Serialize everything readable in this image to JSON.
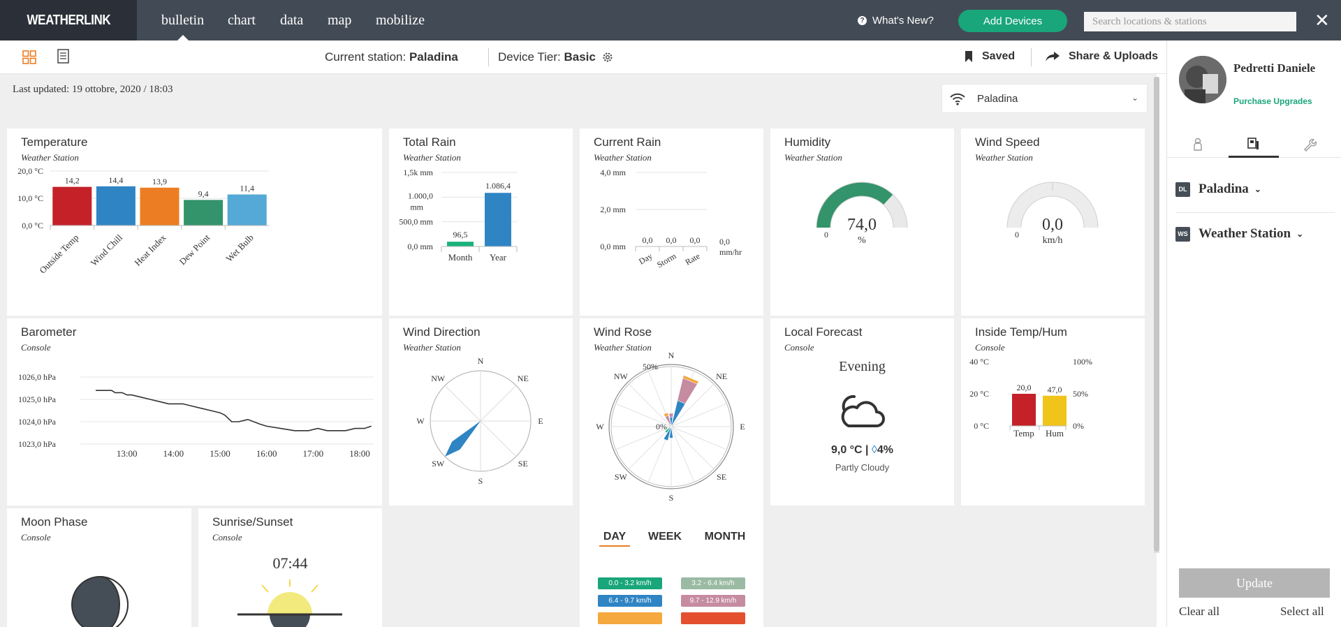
{
  "app": {
    "logo": "WEATHERLINK"
  },
  "nav": [
    {
      "label": "bulletin",
      "active": true
    },
    {
      "label": "chart"
    },
    {
      "label": "data"
    },
    {
      "label": "map"
    },
    {
      "label": "mobilize"
    }
  ],
  "header": {
    "whats_new": "What's New?",
    "add_devices": "Add Devices",
    "search_placeholder": "Search locations & stations",
    "close": "✕"
  },
  "toolbar": {
    "current_station_label": "Current station:",
    "current_station": "Paladina",
    "device_tier_label": "Device Tier:",
    "device_tier": "Basic",
    "saved": "Saved",
    "share": "Share & Uploads"
  },
  "main": {
    "last_updated": "Last updated: 19 ottobre, 2020 / 18:03",
    "station_selector": "Paladina"
  },
  "cards": {
    "temperature": {
      "title": "Temperature",
      "subtitle": "Weather Station",
      "chart_data": {
        "type": "bar",
        "categories": [
          "Outside Temp",
          "Wind Chill",
          "Heat Index",
          "Dew Point",
          "Wet Bulb"
        ],
        "values": [
          14.2,
          14.4,
          13.9,
          9.4,
          11.4
        ],
        "labels": [
          "14,2",
          "14,4",
          "13,9",
          "9,4",
          "11,4"
        ],
        "colors": [
          "#c52128",
          "#2f85c4",
          "#ec7d23",
          "#33936a",
          "#54a9d6"
        ],
        "ylim": [
          0,
          20
        ],
        "yticks": [
          {
            "v": 0,
            "label": "0,0 °C"
          },
          {
            "v": 10,
            "label": "10,0 °C"
          },
          {
            "v": 20,
            "label": "20,0 °C"
          }
        ]
      }
    },
    "total_rain": {
      "title": "Total Rain",
      "subtitle": "Weather Station",
      "chart_data": {
        "type": "bar",
        "categories": [
          "Month",
          "Year"
        ],
        "values": [
          96.5,
          1086.4
        ],
        "labels": [
          "96,5",
          "1.086,4"
        ],
        "colors": [
          "#19b37b",
          "#2f85c4"
        ],
        "ylim": [
          0,
          1500
        ],
        "yticks": [
          {
            "v": 0,
            "label": "0,0 mm"
          },
          {
            "v": 500,
            "label": "500,0 mm"
          },
          {
            "v": 1000,
            "label": "1.000,0 mm"
          },
          {
            "v": 1500,
            "label": "1,5k mm"
          }
        ]
      }
    },
    "current_rain": {
      "title": "Current Rain",
      "subtitle": "Weather Station",
      "chart_data": {
        "type": "bar",
        "categories": [
          "Day",
          "Storm",
          "Rate"
        ],
        "values": [
          0.0,
          0.0,
          0.0
        ],
        "labels": [
          "0,0",
          "0,0",
          "0,0"
        ],
        "ylim": [
          0,
          4
        ],
        "yticks": [
          {
            "v": 0,
            "label": "0,0 mm"
          },
          {
            "v": 2,
            "label": "2,0 mm"
          },
          {
            "v": 4,
            "label": "4,0 mm"
          }
        ],
        "rate_value": "0,0",
        "rate_unit": "mm/hr"
      }
    },
    "humidity": {
      "title": "Humidity",
      "subtitle": "Weather Station",
      "value": 74.0,
      "value_label": "74,0",
      "unit": "%",
      "min_label": "0",
      "max": 100,
      "color": "#33936a"
    },
    "wind_speed": {
      "title": "Wind Speed",
      "subtitle": "Weather Station",
      "value": 0.0,
      "value_label": "0,0",
      "unit": "km/h",
      "min_label": "0"
    },
    "barometer": {
      "title": "Barometer",
      "subtitle": "Console",
      "chart_data": {
        "type": "line",
        "x": [
          12.33,
          12.67,
          12.75,
          12.9,
          13.0,
          13.1,
          13.3,
          13.5,
          13.7,
          13.9,
          14.2,
          14.4,
          14.6,
          14.8,
          15.0,
          15.1,
          15.25,
          15.4,
          15.6,
          15.85,
          16.0,
          16.3,
          16.6,
          16.9,
          17.1,
          17.3,
          17.5,
          17.7,
          17.9,
          18.1,
          18.25
        ],
        "values": [
          1025.4,
          1025.4,
          1025.3,
          1025.3,
          1025.2,
          1025.2,
          1025.1,
          1025.0,
          1024.9,
          1024.8,
          1024.8,
          1024.7,
          1024.6,
          1024.5,
          1024.4,
          1024.3,
          1024.0,
          1024.0,
          1024.1,
          1023.9,
          1023.8,
          1023.7,
          1023.6,
          1023.6,
          1023.7,
          1023.6,
          1023.6,
          1023.6,
          1023.7,
          1023.7,
          1023.8
        ],
        "ylim": [
          1023,
          1026
        ],
        "yticks": [
          {
            "v": 1023,
            "label": "1023,0 hPa"
          },
          {
            "v": 1024,
            "label": "1024,0 hPa"
          },
          {
            "v": 1025,
            "label": "1025,0 hPa"
          },
          {
            "v": 1026,
            "label": "1026,0 hPa"
          }
        ],
        "xlim": [
          12.0,
          18.3
        ],
        "xticks": [
          {
            "v": 13,
            "label": "13:00"
          },
          {
            "v": 14,
            "label": "14:00"
          },
          {
            "v": 15,
            "label": "15:00"
          },
          {
            "v": 16,
            "label": "16:00"
          },
          {
            "v": 17,
            "label": "17:00"
          },
          {
            "v": 18,
            "label": "18:00"
          }
        ]
      }
    },
    "wind_direction": {
      "title": "Wind Direction",
      "subtitle": "Weather Station",
      "directions": [
        "N",
        "NE",
        "E",
        "SE",
        "S",
        "SW",
        "W",
        "NW"
      ],
      "arrow_bearing": 225
    },
    "wind_rose": {
      "title": "Wind Rose",
      "subtitle": "Weather Station",
      "directions": [
        "N",
        "NE",
        "E",
        "SE",
        "S",
        "SW",
        "W",
        "NW"
      ],
      "ring_labels": [
        "50%",
        "0%"
      ],
      "petals": [
        {
          "bearing": 22.5,
          "segments": [
            {
              "to": 0.28,
              "color": "#2f85c4"
            },
            {
              "to": 0.52,
              "color": "#c58ba1"
            },
            {
              "to": 0.55,
              "color": "#f5a83d"
            }
          ]
        },
        {
          "bearing": 0,
          "segments": [
            {
              "to": 0.1,
              "color": "#2f85c4"
            },
            {
              "to": 0.14,
              "color": "#c58ba1"
            }
          ]
        },
        {
          "bearing": 337.5,
          "segments": [
            {
              "to": 0.12,
              "color": "#c58ba1"
            },
            {
              "to": 0.15,
              "color": "#f5a83d"
            }
          ]
        },
        {
          "bearing": 202.5,
          "segments": [
            {
              "to": 0.15,
              "color": "#2f85c4"
            }
          ]
        },
        {
          "bearing": 180,
          "segments": [
            {
              "to": 0.12,
              "color": "#2f85c4"
            }
          ]
        },
        {
          "bearing": 225,
          "segments": [
            {
              "to": 0.08,
              "color": "#19b37b"
            }
          ]
        }
      ],
      "tabs": [
        "DAY",
        "WEEK",
        "MONTH"
      ],
      "active_tab": 0,
      "legend": [
        {
          "label": "0.0 - 3.2 km/h",
          "color": "#19a67a"
        },
        {
          "label": "3.2 - 6.4 km/h",
          "color": "#9bbaa3"
        },
        {
          "label": "6.4 - 9.7 km/h",
          "color": "#2f85c4"
        },
        {
          "label": "9.7 - 12.9 km/h",
          "color": "#c58ba1"
        }
      ]
    },
    "forecast": {
      "title": "Local Forecast",
      "subtitle": "Console",
      "period": "Evening",
      "temp": "9,0 °C",
      "precip": "4%",
      "condition": "Partly Cloudy"
    },
    "inside": {
      "title": "Inside Temp/Hum",
      "subtitle": "Console",
      "chart_data": {
        "type": "bar",
        "categories": [
          "Temp",
          "Hum"
        ],
        "values": [
          20.0,
          47.0
        ],
        "labels": [
          "20,0",
          "47,0"
        ],
        "colors": [
          "#c52128",
          "#f0c419"
        ],
        "left_ticks": [
          {
            "v": 0,
            "label": "0 °C"
          },
          {
            "v": 20,
            "label": "20 °C"
          },
          {
            "v": 40,
            "label": "40 °C"
          }
        ],
        "right_ticks": [
          {
            "v": 0,
            "label": "0%"
          },
          {
            "v": 50,
            "label": "50%"
          },
          {
            "v": 100,
            "label": "100%"
          }
        ]
      }
    },
    "moon": {
      "title": "Moon Phase",
      "subtitle": "Console"
    },
    "sunrise": {
      "title": "Sunrise/Sunset",
      "subtitle": "Console",
      "time": "07:44"
    }
  },
  "panel": {
    "user_name": "Pedretti Daniele",
    "purchase": "Purchase Upgrades",
    "devices": [
      {
        "badge": "DL",
        "name": "Paladina"
      },
      {
        "badge": "WS",
        "name": "Weather Station"
      }
    ],
    "update": "Update",
    "clear_all": "Clear all",
    "select_all": "Select all"
  }
}
